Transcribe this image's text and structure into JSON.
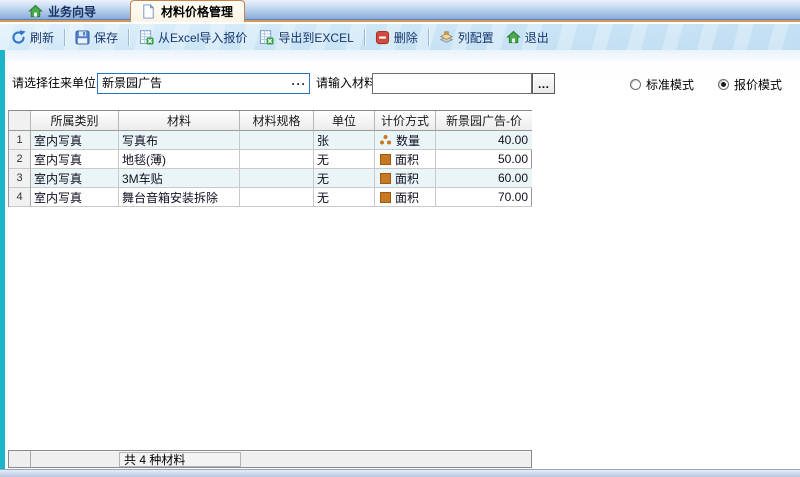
{
  "tabs": {
    "items": [
      {
        "label": "业务向导"
      },
      {
        "label": "材料价格管理"
      }
    ]
  },
  "toolbar": {
    "buttons": [
      {
        "label": "刷新"
      },
      {
        "label": "保存"
      },
      {
        "label": "从Excel导入报价"
      },
      {
        "label": "导出到EXCEL"
      },
      {
        "label": "删除"
      },
      {
        "label": "列配置"
      },
      {
        "label": "退出"
      }
    ]
  },
  "filters": {
    "partner_label": "请选择往来单位",
    "partner_value": "新景园广告",
    "material_label": "请输入材料",
    "material_value": "",
    "ellipsis": "···",
    "ellipsis_button": "…"
  },
  "modes": {
    "standard": "标准模式",
    "quote": "报价模式",
    "selected": "报价模式"
  },
  "grid": {
    "columns": [
      "所属类别",
      "材料",
      "材料规格",
      "单位",
      "计价方式",
      "新景园广告-价"
    ],
    "rows": [
      {
        "num": "1",
        "category": "室内写真",
        "material": "写真布",
        "spec": "",
        "unit": "张",
        "pricing": "数量",
        "pricing_icon": "quantity-dots",
        "price": "40.00"
      },
      {
        "num": "2",
        "category": "室内写真",
        "material": "地毯(薄)",
        "spec": "",
        "unit": "无",
        "pricing": "面积",
        "pricing_icon": "area-square",
        "price": "50.00"
      },
      {
        "num": "3",
        "category": "室内写真",
        "material": "3M车贴",
        "spec": "",
        "unit": "无",
        "pricing": "面积",
        "pricing_icon": "area-square",
        "price": "60.00"
      },
      {
        "num": "4",
        "category": "室内写真",
        "material": "舞台音箱安装拆除",
        "spec": "",
        "unit": "无",
        "pricing": "面积",
        "pricing_icon": "area-square",
        "price": "70.00"
      }
    ]
  },
  "status": {
    "total": "共 4 种材料"
  },
  "colors": {
    "accent_orange": "#c87820",
    "tab_active_border": "#c8824a",
    "teal_strip": "#1ab5c9",
    "toolbar_text": "#17356e",
    "delete_red": "#d24a3e",
    "house_green": "#4aa94e",
    "combo_border": "#2f6fc0"
  }
}
